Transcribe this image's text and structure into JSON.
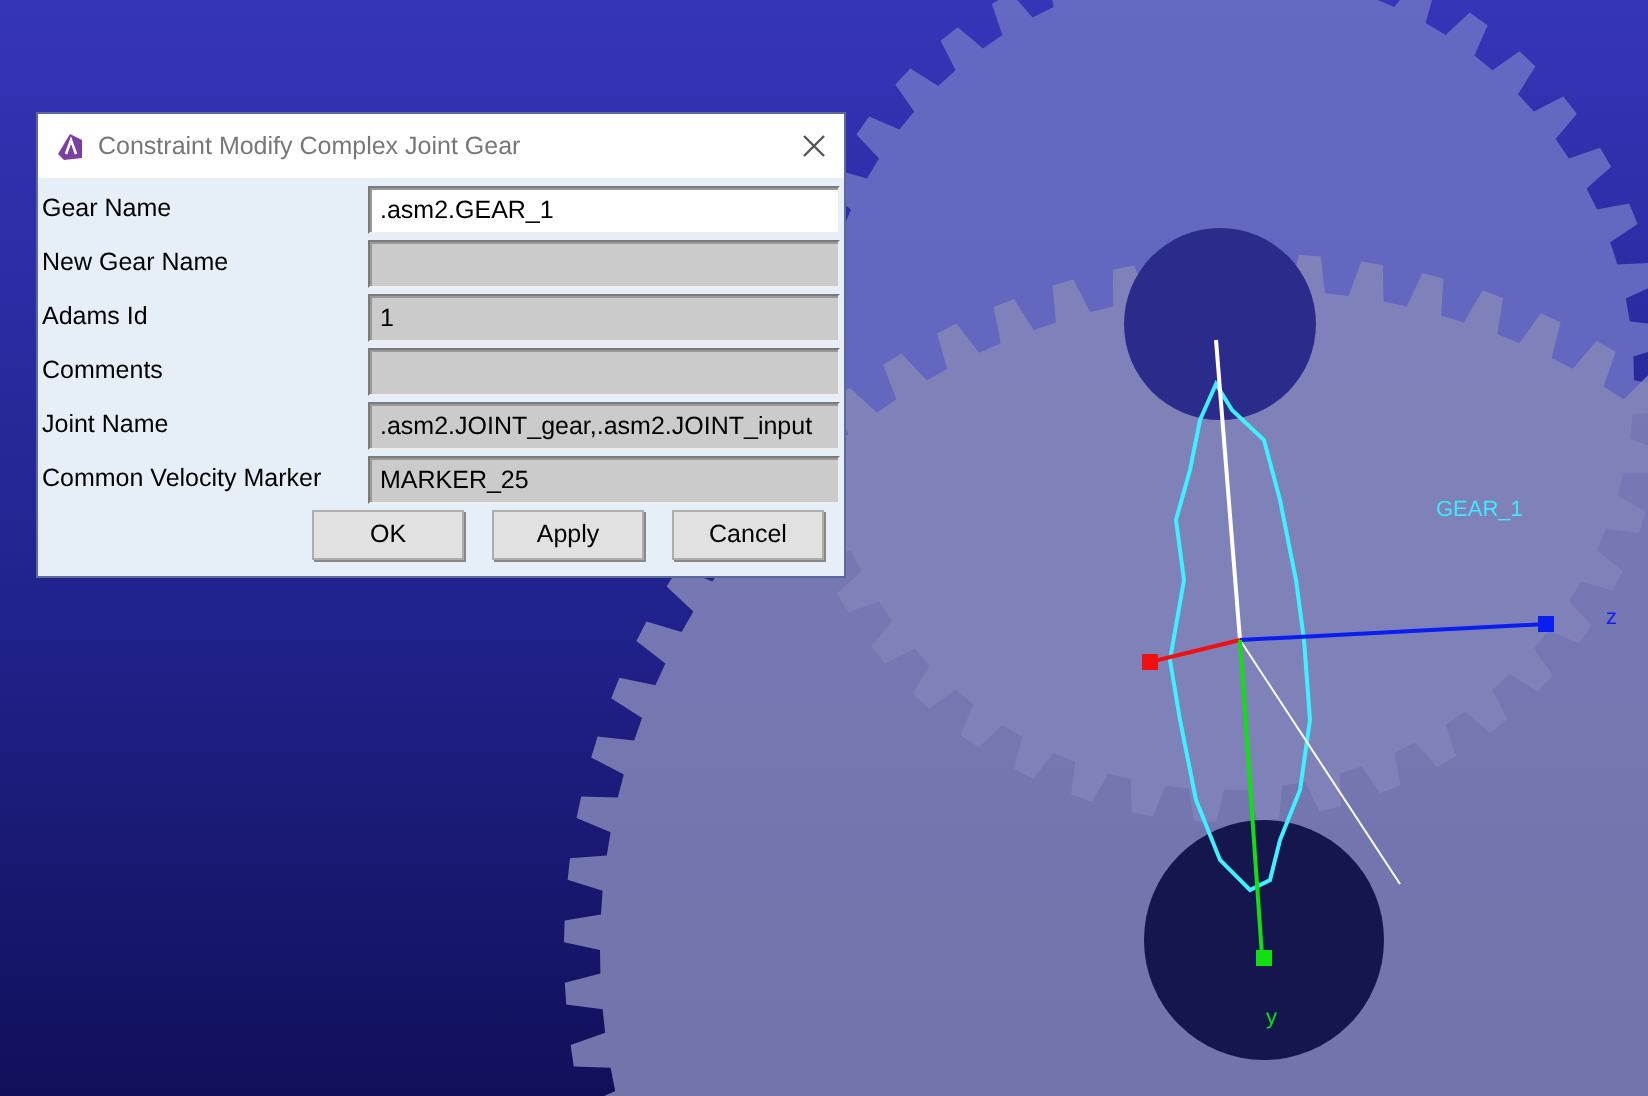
{
  "viewport": {
    "labels": [
      {
        "kind": "gear",
        "text": "GEAR_1"
      },
      {
        "kind": "z",
        "text": "z"
      },
      {
        "kind": "y",
        "text": "y"
      }
    ]
  },
  "dialog": {
    "title": "Constraint Modify Complex Joint Gear",
    "fields": [
      {
        "label": "Gear Name",
        "value": ".asm2.GEAR_1",
        "editable": true
      },
      {
        "label": "New Gear Name",
        "editable": false
      },
      {
        "label": "Adams Id",
        "value": "1",
        "editable": false
      },
      {
        "label": "Comments",
        "editable": false
      },
      {
        "label": "Joint Name",
        "value": ".asm2.JOINT_gear,.asm2.JOINT_input",
        "editable": false
      },
      {
        "label": "Common Velocity Marker",
        "value": "MARKER_25",
        "editable": false
      }
    ],
    "buttons": [
      "OK",
      "Apply",
      "Cancel"
    ]
  }
}
